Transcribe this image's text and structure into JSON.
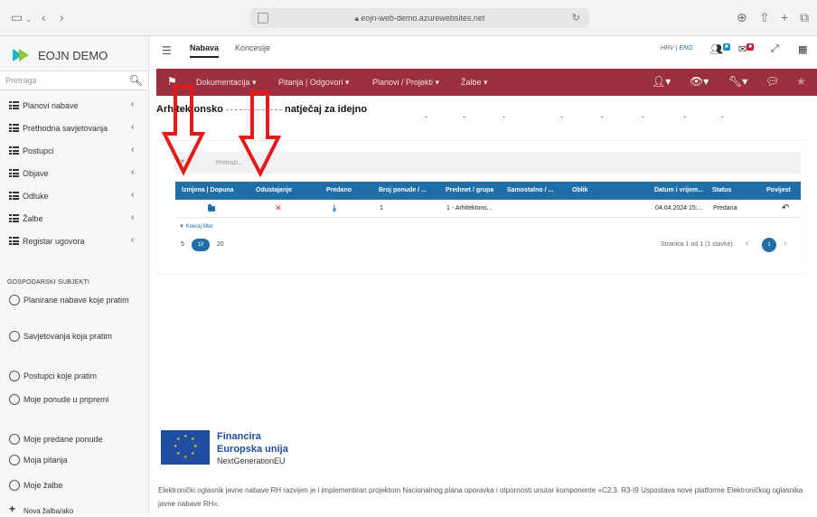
{
  "browser": {
    "url": "eojn-web-demo.azurewebsites.net"
  },
  "sidebar": {
    "logo": "EOJN DEMO",
    "search_placeholder": "Pretraga",
    "items": [
      {
        "label": "Planovi nabave"
      },
      {
        "label": "Prethodna savjetovanja"
      },
      {
        "label": "Postupci"
      },
      {
        "label": "Objave"
      },
      {
        "label": "Odluke"
      },
      {
        "label": "Žalbe"
      },
      {
        "label": "Registar ugovora"
      }
    ],
    "section_header": "GOSPODARSKI SUBJEKTI",
    "subjects": [
      {
        "label": "Planirane nabave koje pratim"
      },
      {
        "label": "Savjetovanja koja pratim"
      },
      {
        "label": "Postupci koje pratim"
      },
      {
        "label": "Moje ponude u pripremi"
      },
      {
        "label": "Moje predane ponude"
      },
      {
        "label": "Moja pitanja"
      },
      {
        "label": "Moje žalbe"
      },
      {
        "label": "Nova žalba/ako"
      }
    ]
  },
  "topbar": {
    "tabs": [
      "Nabava",
      "Koncesije"
    ],
    "lang_hrv": "HRV",
    "lang_sep": "|",
    "lang_eng": "ENG"
  },
  "rednav": {
    "items": [
      "Dokumentacija",
      "Pitanja | Odgovori",
      "Planovi / Projekti",
      "Žalbe"
    ]
  },
  "page": {
    "title_left": "Arhitektonsko",
    "title_right": "natječaj za idejno"
  },
  "table": {
    "filter_placeholder": "Pretraži...",
    "headers": [
      "Izmjena | Dopuna",
      "Odustajanje",
      "Predano",
      "Broj ponude / ...",
      "Predmet / grupa",
      "Samostalno / ...",
      "Oblik",
      "Datum i vrijem...",
      "Status",
      "Povijest"
    ],
    "rows": [
      {
        "broj": "1",
        "predmet": "1 - Arhitektons...",
        "samostalno": "",
        "oblik": "",
        "datum": "04.04.2024 15:...",
        "status": "Predana"
      }
    ],
    "kreiraj_filter": "Kreiraj filter",
    "page_sizes": [
      "5",
      "10",
      "20"
    ],
    "active_page_size": "10",
    "pagination_text": "Stranica 1 od 1 (1 stavke)",
    "current_page": "1"
  },
  "footer": {
    "financira": "Financira",
    "eu": "Europska unija",
    "ngeu": "NextGenerationEU",
    "text": "Elektronički oglasnik javne nabave RH razvijen je i implementiran projektom Nacionalnog plana oporavka i otpornosti unutar komponente »C2.3. R3-I9 Uspostava nove platforme Elektroničkog oglasnika javne nabave RH«."
  },
  "colors": {
    "nav_red": "#9c2f3d",
    "table_blue": "#1e6ea7",
    "arrow_red": "#e81818"
  }
}
